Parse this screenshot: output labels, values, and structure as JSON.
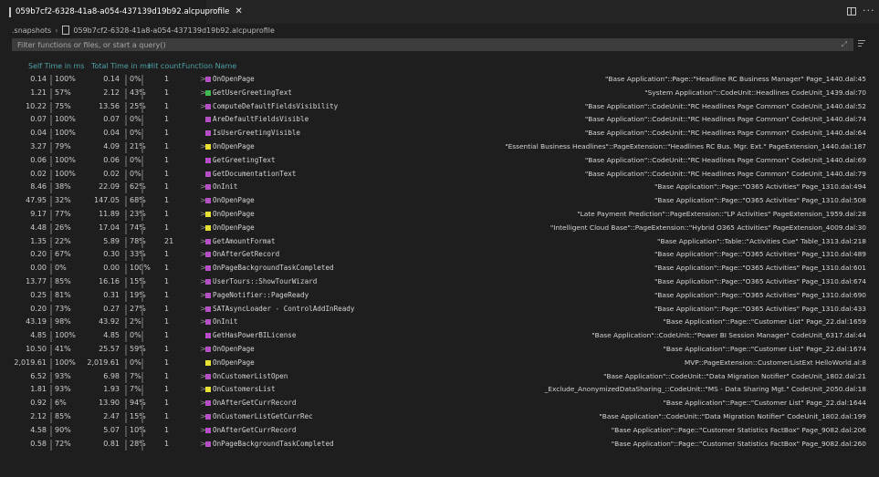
{
  "tab": {
    "title": "059b7cf2-6328-41a8-a054-437139d19b92.alcpuprofile",
    "close": "✕"
  },
  "breadcrumb": {
    "root": ".snapshots",
    "sep": "›",
    "file": "059b7cf2-6328-41a8-a054-437139d19b92.alcpuprofile"
  },
  "filter": {
    "placeholder": "Filter functions or files, or start a query()"
  },
  "columns": {
    "self": "Self Time in ms",
    "total": "Total Time in ms",
    "hits": "Hit count",
    "name": "Function Name"
  },
  "colors": {
    "purple": "#b44fc4",
    "yellow": "#e8e035",
    "header": "#4ea1a9"
  },
  "rows": [
    {
      "self": "0.14",
      "self_pct": "100%",
      "total": "0.14",
      "total_pct": "0%",
      "hits": "1",
      "chevron": ">",
      "color": "purple",
      "name": "OnOpenPage",
      "loc": "\"Base Application\"::Page::\"Headline RC Business Manager\" Page_1440.dal:45"
    },
    {
      "self": "1.21",
      "self_pct": "57%",
      "total": "2.12",
      "total_pct": "43%",
      "hits": "1",
      "chevron": ">",
      "color": "green",
      "name": "GetUserGreetingText",
      "loc": "\"System Application\"::CodeUnit::Headlines CodeUnit_1439.dal:70"
    },
    {
      "self": "10.22",
      "self_pct": "75%",
      "total": "13.56",
      "total_pct": "25%",
      "hits": "1",
      "chevron": ">",
      "color": "purple",
      "name": "ComputeDefaultFieldsVisibility",
      "loc": "\"Base Application\"::CodeUnit::\"RC Headlines Page Common\" CodeUnit_1440.dal:52"
    },
    {
      "self": "0.07",
      "self_pct": "100%",
      "total": "0.07",
      "total_pct": "0%",
      "hits": "1",
      "chevron": "",
      "color": "purple",
      "name": "AreDefaultFieldsVisible",
      "loc": "\"Base Application\"::CodeUnit::\"RC Headlines Page Common\" CodeUnit_1440.dal:74"
    },
    {
      "self": "0.04",
      "self_pct": "100%",
      "total": "0.04",
      "total_pct": "0%",
      "hits": "1",
      "chevron": "",
      "color": "purple",
      "name": "IsUserGreetingVisible",
      "loc": "\"Base Application\"::CodeUnit::\"RC Headlines Page Common\" CodeUnit_1440.dal:64"
    },
    {
      "self": "3.27",
      "self_pct": "79%",
      "total": "4.09",
      "total_pct": "21%",
      "hits": "1",
      "chevron": ">",
      "color": "yellow",
      "name": "OnOpenPage",
      "loc": "\"Essential Business Headlines\"::PageExtension::\"Headlines RC Bus. Mgr. Ext.\" PageExtension_1440.dal:187"
    },
    {
      "self": "0.06",
      "self_pct": "100%",
      "total": "0.06",
      "total_pct": "0%",
      "hits": "1",
      "chevron": "",
      "color": "purple",
      "name": "GetGreetingText",
      "loc": "\"Base Application\"::CodeUnit::\"RC Headlines Page Common\" CodeUnit_1440.dal:69"
    },
    {
      "self": "0.02",
      "self_pct": "100%",
      "total": "0.02",
      "total_pct": "0%",
      "hits": "1",
      "chevron": "",
      "color": "purple",
      "name": "GetDocumentationText",
      "loc": "\"Base Application\"::CodeUnit::\"RC Headlines Page Common\" CodeUnit_1440.dal:79"
    },
    {
      "self": "8.46",
      "self_pct": "38%",
      "total": "22.09",
      "total_pct": "62%",
      "hits": "1",
      "chevron": ">",
      "color": "purple",
      "name": "OnInit",
      "loc": "\"Base Application\"::Page::\"O365 Activities\" Page_1310.dal:494"
    },
    {
      "self": "47.95",
      "self_pct": "32%",
      "total": "147.05",
      "total_pct": "68%",
      "hits": "1",
      "chevron": ">",
      "color": "purple",
      "name": "OnOpenPage",
      "loc": "\"Base Application\"::Page::\"O365 Activities\" Page_1310.dal:508"
    },
    {
      "self": "9.17",
      "self_pct": "77%",
      "total": "11.89",
      "total_pct": "23%",
      "hits": "1",
      "chevron": ">",
      "color": "yellow",
      "name": "OnOpenPage",
      "loc": "\"Late Payment Prediction\"::PageExtension::\"LP Activities\" PageExtension_1959.dal:28"
    },
    {
      "self": "4.48",
      "self_pct": "26%",
      "total": "17.04",
      "total_pct": "74%",
      "hits": "1",
      "chevron": ">",
      "color": "yellow",
      "name": "OnOpenPage",
      "loc": "\"Intelligent Cloud Base\"::PageExtension::\"Hybrid O365 Activities\" PageExtension_4009.dal:30"
    },
    {
      "self": "1.35",
      "self_pct": "22%",
      "total": "5.89",
      "total_pct": "78%",
      "hits": "21",
      "chevron": ">",
      "color": "purple",
      "name": "GetAmountFormat",
      "loc": "\"Base Application\"::Table::\"Activities Cue\" Table_1313.dal:218"
    },
    {
      "self": "0.20",
      "self_pct": "67%",
      "total": "0.30",
      "total_pct": "33%",
      "hits": "1",
      "chevron": ">",
      "color": "purple",
      "name": "OnAfterGetRecord",
      "loc": "\"Base Application\"::Page::\"O365 Activities\" Page_1310.dal:489"
    },
    {
      "self": "0.00",
      "self_pct": "0%",
      "total": "0.00",
      "total_pct": "100%",
      "hits": "1",
      "chevron": ">",
      "color": "purple",
      "name": "OnPageBackgroundTaskCompleted",
      "loc": "\"Base Application\"::Page::\"O365 Activities\" Page_1310.dal:601"
    },
    {
      "self": "13.77",
      "self_pct": "85%",
      "total": "16.16",
      "total_pct": "15%",
      "hits": "1",
      "chevron": ">",
      "color": "purple",
      "name": "UserTours::ShowTourWizard",
      "loc": "\"Base Application\"::Page::\"O365 Activities\" Page_1310.dal:674"
    },
    {
      "self": "0.25",
      "self_pct": "81%",
      "total": "0.31",
      "total_pct": "19%",
      "hits": "1",
      "chevron": ">",
      "color": "purple",
      "name": "PageNotifier::PageReady",
      "loc": "\"Base Application\"::Page::\"O365 Activities\" Page_1310.dal:690"
    },
    {
      "self": "0.20",
      "self_pct": "73%",
      "total": "0.27",
      "total_pct": "27%",
      "hits": "1",
      "chevron": ">",
      "color": "purple",
      "name": "SATAsyncLoader - ControlAddInReady",
      "loc": "\"Base Application\"::Page::\"O365 Activities\" Page_1310.dal:433"
    },
    {
      "self": "43.19",
      "self_pct": "98%",
      "total": "43.92",
      "total_pct": "2%",
      "hits": "1",
      "chevron": ">",
      "color": "purple",
      "name": "OnInit",
      "loc": "\"Base Application\"::Page::\"Customer List\" Page_22.dal:1659"
    },
    {
      "self": "4.85",
      "self_pct": "100%",
      "total": "4.85",
      "total_pct": "0%",
      "hits": "1",
      "chevron": "",
      "color": "purple",
      "name": "GetHasPowerBILicense",
      "loc": "\"Base Application\"::CodeUnit::\"Power BI Session Manager\" CodeUnit_6317.dal:44"
    },
    {
      "self": "10.50",
      "self_pct": "41%",
      "total": "25.57",
      "total_pct": "59%",
      "hits": "1",
      "chevron": ">",
      "color": "purple",
      "name": "OnOpenPage",
      "loc": "\"Base Application\"::Page::\"Customer List\" Page_22.dal:1674"
    },
    {
      "self": "2,019.61",
      "self_pct": "100%",
      "total": "2,019.61",
      "total_pct": "0%",
      "hits": "1",
      "chevron": "",
      "color": "yellow",
      "name": "OnOpenPage",
      "loc": "MVP::PageExtension::CustomerListExt HelloWorld.al:8"
    },
    {
      "self": "6.52",
      "self_pct": "93%",
      "total": "6.98",
      "total_pct": "7%",
      "hits": "1",
      "chevron": ">",
      "color": "purple",
      "name": "OnCustomerListOpen",
      "loc": "\"Base Application\"::CodeUnit::\"Data Migration Notifier\" CodeUnit_1802.dal:21"
    },
    {
      "self": "1.81",
      "self_pct": "93%",
      "total": "1.93",
      "total_pct": "7%",
      "hits": "1",
      "chevron": ">",
      "color": "yellow",
      "name": "OnCustomersList",
      "loc": "_Exclude_AnonymizedDataSharing_::CodeUnit::\"MS - Data Sharing Mgt.\" CodeUnit_2050.dal:18"
    },
    {
      "self": "0.92",
      "self_pct": "6%",
      "total": "13.90",
      "total_pct": "94%",
      "hits": "1",
      "chevron": ">",
      "color": "purple",
      "name": "OnAfterGetCurrRecord",
      "loc": "\"Base Application\"::Page::\"Customer List\" Page_22.dal:1644"
    },
    {
      "self": "2.12",
      "self_pct": "85%",
      "total": "2.47",
      "total_pct": "15%",
      "hits": "1",
      "chevron": ">",
      "color": "purple",
      "name": "OnCustomerListGetCurrRec",
      "loc": "\"Base Application\"::CodeUnit::\"Data Migration Notifier\" CodeUnit_1802.dal:199"
    },
    {
      "self": "4.58",
      "self_pct": "90%",
      "total": "5.07",
      "total_pct": "10%",
      "hits": "1",
      "chevron": ">",
      "color": "purple",
      "name": "OnAfterGetCurrRecord",
      "loc": "\"Base Application\"::Page::\"Customer Statistics FactBox\" Page_9082.dal:206"
    },
    {
      "self": "0.58",
      "self_pct": "72%",
      "total": "0.81",
      "total_pct": "28%",
      "hits": "1",
      "chevron": ">",
      "color": "purple",
      "name": "OnPageBackgroundTaskCompleted",
      "loc": "\"Base Application\"::Page::\"Customer Statistics FactBox\" Page_9082.dal:260"
    }
  ]
}
